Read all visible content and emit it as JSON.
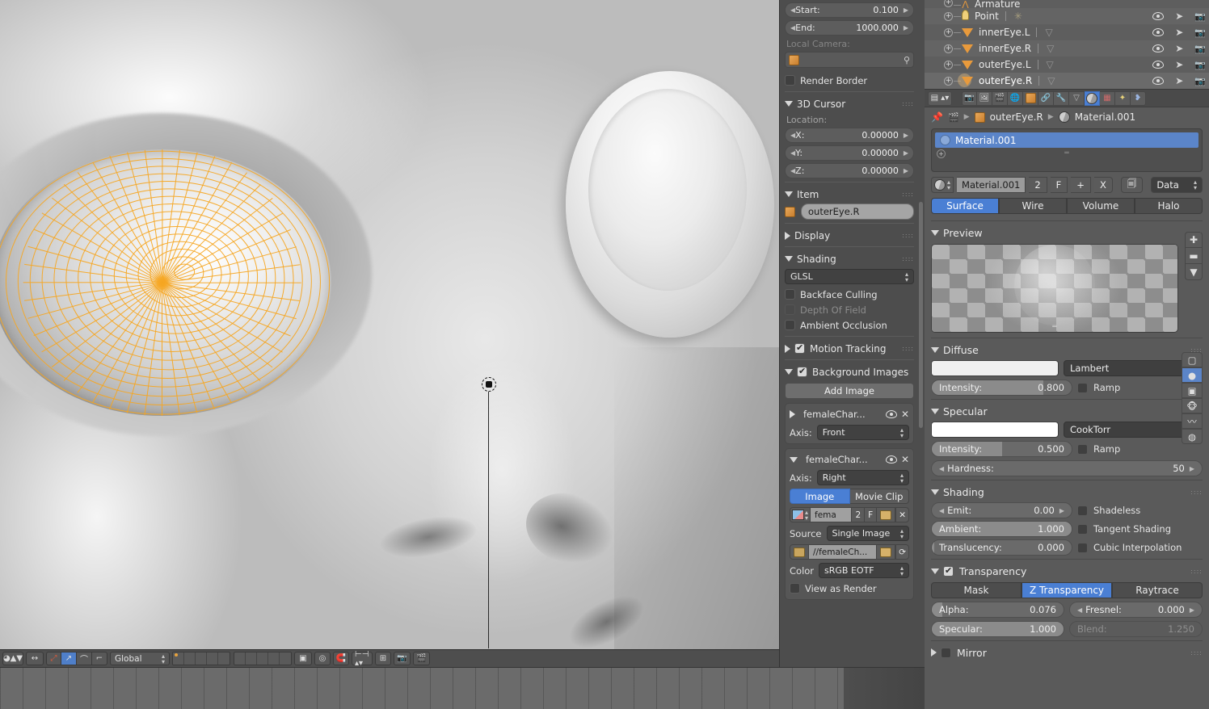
{
  "viewport": {
    "cursor_name": "3d-cursor",
    "header": {
      "transform_orientation": "Global",
      "icons": [
        "editor-type-icon",
        "object-mode-icon",
        "viewport-shading-icon",
        "translate-manipulator-icon",
        "rotate-manipulator-icon",
        "scale-manipulator-icon",
        "snap-magnet-icon",
        "proportional-edit-icon",
        "render-button-icon",
        "camera-button-icon"
      ]
    }
  },
  "npanel": {
    "view_fields": [
      {
        "label": "Start:",
        "value": "0.100"
      },
      {
        "label": "End:",
        "value": "1000.000"
      }
    ],
    "local_camera_label": "Local Camera:",
    "render_border_label": "Render Border",
    "cursor_section": {
      "title": "3D Cursor",
      "location_label": "Location:",
      "fields": [
        {
          "label": "X:",
          "value": "0.00000"
        },
        {
          "label": "Y:",
          "value": "0.00000"
        },
        {
          "label": "Z:",
          "value": "0.00000"
        }
      ]
    },
    "item_section": {
      "title": "Item",
      "object_name": "outerEye.R"
    },
    "display_section": {
      "title": "Display"
    },
    "shading_section": {
      "title": "Shading",
      "method": "GLSL",
      "options": [
        {
          "label": "Backface Culling",
          "checked": false,
          "enabled": true
        },
        {
          "label": "Depth Of Field",
          "checked": false,
          "enabled": false
        },
        {
          "label": "Ambient Occlusion",
          "checked": false,
          "enabled": true
        }
      ]
    },
    "motion_tracking": {
      "title": "Motion Tracking",
      "checked": true
    },
    "background_images": {
      "title": "Background Images",
      "checked": true,
      "add_button": "Add Image",
      "images": [
        {
          "name": "femaleChar...",
          "expanded": false,
          "axis_label": "Axis:",
          "axis": "Front"
        },
        {
          "name": "femaleChar...",
          "expanded": true,
          "axis_label": "Axis:",
          "axis": "Right",
          "source_type_tabs": [
            "Image",
            "Movie Clip"
          ],
          "source_type_active": "Image",
          "datablock_name": "fema",
          "datablock_users": "2",
          "datablock_fake": "F",
          "source_label": "Source",
          "source": "Single Image",
          "filepath": "//femaleCh...",
          "color_label": "Color",
          "color_space": "sRGB EOTF",
          "view_as_render_label": "View as Render"
        }
      ]
    }
  },
  "outliner": {
    "rows": [
      {
        "name": "Armature",
        "type": "armature",
        "partial": true,
        "active": false
      },
      {
        "name": "Point",
        "type": "lamp",
        "active": false
      },
      {
        "name": "innerEye.L",
        "type": "mesh",
        "active": false
      },
      {
        "name": "innerEye.R",
        "type": "mesh",
        "active": false
      },
      {
        "name": "outerEye.L",
        "type": "mesh",
        "active": false
      },
      {
        "name": "outerEye.R",
        "type": "mesh",
        "active": true
      }
    ],
    "row_icons": [
      "eye-icon",
      "cursor-arrow-icon",
      "camera-icon"
    ]
  },
  "properties": {
    "tabs": [
      {
        "name": "render-tab",
        "active": false
      },
      {
        "name": "render-layers-tab",
        "active": false
      },
      {
        "name": "scene-tab",
        "active": false
      },
      {
        "name": "world-tab",
        "active": false
      },
      {
        "name": "object-tab",
        "active": false
      },
      {
        "name": "constraints-tab",
        "active": false
      },
      {
        "name": "modifiers-tab",
        "active": false
      },
      {
        "name": "object-data-tab",
        "active": false
      },
      {
        "name": "material-tab",
        "active": true
      },
      {
        "name": "texture-tab",
        "active": false
      },
      {
        "name": "particles-tab",
        "active": false
      },
      {
        "name": "physics-tab",
        "active": false
      }
    ],
    "breadcrumb": {
      "object": "outerEye.R",
      "material": "Material.001"
    },
    "material_slots": [
      {
        "name": "Material.001",
        "selected": true
      }
    ],
    "id_block": {
      "name": "Material.001",
      "users": "2",
      "fake_user": "F",
      "add": "+",
      "unlink": "X",
      "link": "Data"
    },
    "type_tabs": [
      "Surface",
      "Wire",
      "Volume",
      "Halo"
    ],
    "type_active": "Surface",
    "preview": {
      "title": "Preview",
      "modes": [
        "flat-preview-icon",
        "sphere-preview-icon",
        "cube-preview-icon",
        "monkey-preview-icon",
        "hair-preview-icon",
        "sphere-sky-preview-icon"
      ],
      "active_mode": "sphere-preview-icon"
    },
    "diffuse": {
      "title": "Diffuse",
      "color": "#f0f0f0",
      "shader": "Lambert",
      "intensity_label": "Intensity:",
      "intensity": "0.800",
      "intensity_pct": 80,
      "ramp_label": "Ramp",
      "ramp_checked": false
    },
    "specular": {
      "title": "Specular",
      "color": "#ffffff",
      "shader": "CookTorr",
      "intensity_label": "Intensity:",
      "intensity": "0.500",
      "intensity_pct": 50,
      "ramp_label": "Ramp",
      "ramp_checked": false,
      "hardness_label": "Hardness:",
      "hardness": "50"
    },
    "shading": {
      "title": "Shading",
      "fields": [
        {
          "label": "Emit:",
          "value": "0.00",
          "pct": 0,
          "arrows": true
        },
        {
          "label": "Ambient:",
          "value": "1.000",
          "pct": 100,
          "arrows": false
        },
        {
          "label": "Translucency:",
          "value": "0.000",
          "pct": 2,
          "arrows": false
        }
      ],
      "checks": [
        {
          "label": "Shadeless",
          "checked": false
        },
        {
          "label": "Tangent Shading",
          "checked": false
        },
        {
          "label": "Cubic Interpolation",
          "checked": false
        }
      ]
    },
    "transparency": {
      "title": "Transparency",
      "enabled": true,
      "modes": [
        "Mask",
        "Z Transparency",
        "Raytrace"
      ],
      "active_mode": "Z Transparency",
      "alpha_label": "Alpha:",
      "alpha": "0.076",
      "alpha_pct": 8,
      "fresnel_label": "Fresnel:",
      "fresnel": "0.000",
      "specular_label": "Specular:",
      "specular": "1.000",
      "specular_pct": 100,
      "blend_label": "Blend:",
      "blend": "1.250"
    },
    "mirror": {
      "title": "Mirror",
      "checked": false
    }
  }
}
